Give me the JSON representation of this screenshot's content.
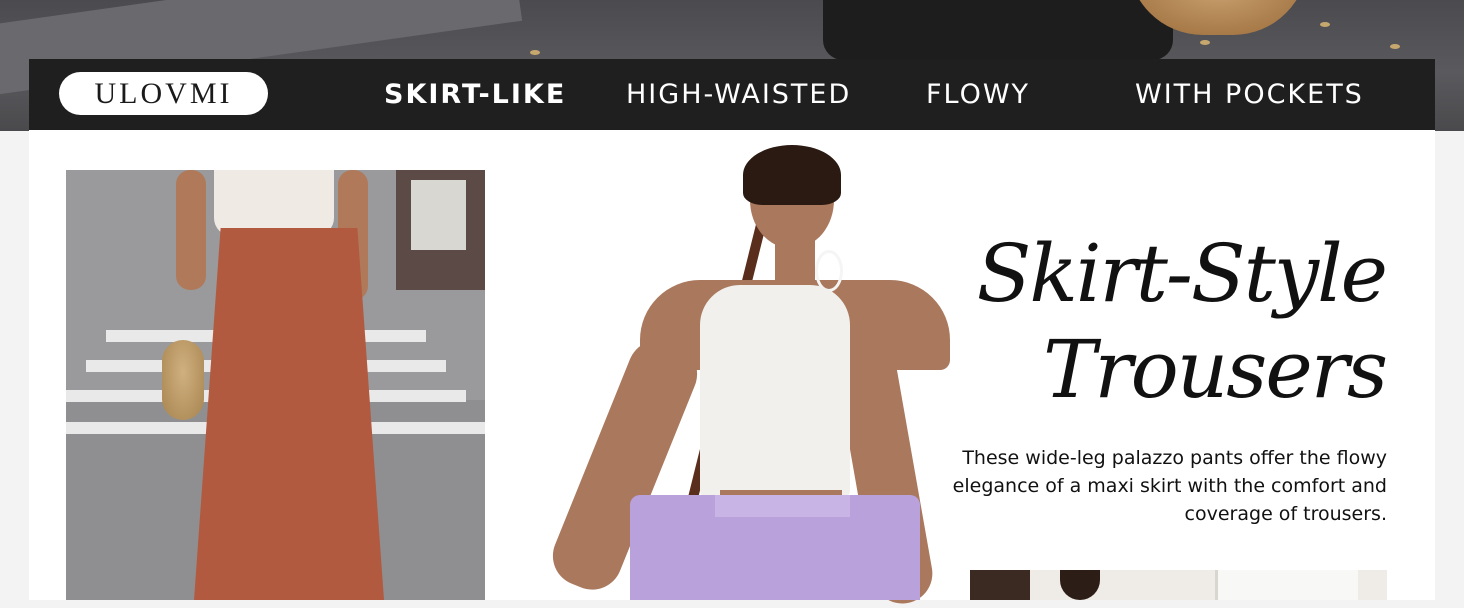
{
  "brand": {
    "logo_text": "ULOVMI"
  },
  "nav": {
    "items": [
      {
        "label": "SKIRT-LIKE",
        "active": true
      },
      {
        "label": "HIGH-WAISTED",
        "active": false
      },
      {
        "label": "FLOWY",
        "active": false
      },
      {
        "label": "WITH POCKETS",
        "active": false
      }
    ]
  },
  "feature": {
    "headline_line1": "Skirt-Style",
    "headline_line2": "Trousers",
    "description": "These wide-leg palazzo pants offer the flowy elegance of a maxi skirt with the comfort and coverage of trousers."
  },
  "colors": {
    "navbar_bg": "#1f1f1f",
    "panel_bg": "#ffffff",
    "page_bg": "#f3f3f3",
    "nav_text": "#ffffff",
    "rust_pants": "#b25a3f",
    "lavender_pants": "#b9a2dc"
  }
}
